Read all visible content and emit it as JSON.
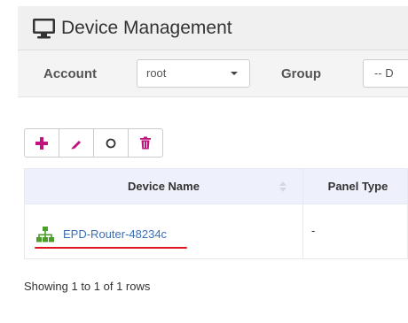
{
  "header": {
    "title": "Device Management",
    "icon": "monitor-icon"
  },
  "filters": {
    "account_label": "Account",
    "account_value": "root",
    "group_label": "Group",
    "group_value": "-- D"
  },
  "toolbar": {
    "buttons": [
      "plus-icon",
      "pencil-icon",
      "circle-icon",
      "trash-icon"
    ],
    "icon_color": "#c0137e"
  },
  "table": {
    "columns": [
      "Device Name",
      "Panel Type"
    ],
    "rows": [
      {
        "device_name": "EPD-Router-48234c",
        "panel_type": "-"
      }
    ],
    "network_icon_color": "#4b9e2a",
    "link_color": "#3a6fb5",
    "header_bg": "#eef0fb"
  },
  "pagination": {
    "summary": "Showing 1 to 1 of 1 rows"
  },
  "annotation": {
    "underline_color": "#e0161f"
  }
}
